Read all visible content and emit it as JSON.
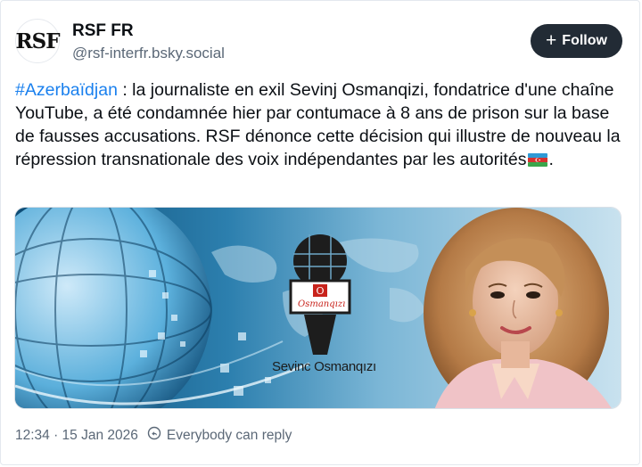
{
  "author": {
    "avatar_text": "RSF",
    "display_name": "RSF FR",
    "handle": "@rsf-interfr.bsky.social"
  },
  "follow_button": {
    "icon": "plus-icon",
    "label": "Follow"
  },
  "post": {
    "hashtag": "#Azerbaïdjan",
    "text_before_flag": " : la journaliste en exil Sevinj Osmanqizi, fondatrice d'une chaîne YouTube, a été condamnée hier par contumace à 8 ans de prison sur la base de fausses accusations. RSF dénonce cette décision qui illustre de nouveau la répression transnationale des voix indépendantes par les autorités",
    "flag_emoji": "azerbaijan-flag",
    "text_after_flag": "."
  },
  "media": {
    "logo_letter": "O",
    "logo_label": "Osmanqızı",
    "caption": "Sevinc Osmanqızı"
  },
  "footer": {
    "timestamp": "12:34 · 15 Jan 2026",
    "reply_icon": "reply-permission-icon",
    "reply_setting": "Everybody can reply"
  },
  "colors": {
    "hashtag": "#1a80ee",
    "follow_bg": "#222b35",
    "muted": "#5b6877"
  }
}
